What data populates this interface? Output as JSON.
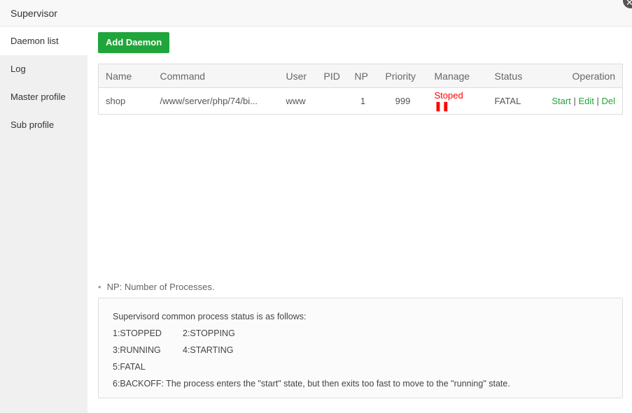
{
  "window": {
    "title": "Supervisor",
    "close_icon": "close-icon"
  },
  "sidebar": {
    "items": [
      {
        "label": "Daemon list",
        "active": true
      },
      {
        "label": "Log"
      },
      {
        "label": "Master profile"
      },
      {
        "label": "Sub profile"
      }
    ]
  },
  "toolbar": {
    "add_label": "Add Daemon"
  },
  "table": {
    "headers": [
      "Name",
      "Command",
      "User",
      "PID",
      "NP",
      "Priority",
      "Manage",
      "Status",
      "Operation"
    ],
    "rows": [
      {
        "name": "shop",
        "command": "/www/server/php/74/bi...",
        "user": "www",
        "pid": "",
        "np": "1",
        "priority": "999",
        "manage": "Stoped",
        "manage_icon": "pause-icon",
        "status": "FATAL",
        "ops": [
          "Start",
          "Edit",
          "Del"
        ]
      }
    ]
  },
  "note": "NP:  Number of Processes.",
  "status_box": {
    "title": "Supervisord common process status is as follows:",
    "s1": "1:STOPPED",
    "s2": "2:STOPPING",
    "s3": "3:RUNNING",
    "s4": "4:STARTING",
    "s5": "5:FATAL",
    "s6": "6:BACKOFF:  The process enters the \"start\" state, but then exits too fast to move to the \"running\" state."
  },
  "colors": {
    "accent": "#20a53a",
    "stopped": "#ff0000"
  }
}
